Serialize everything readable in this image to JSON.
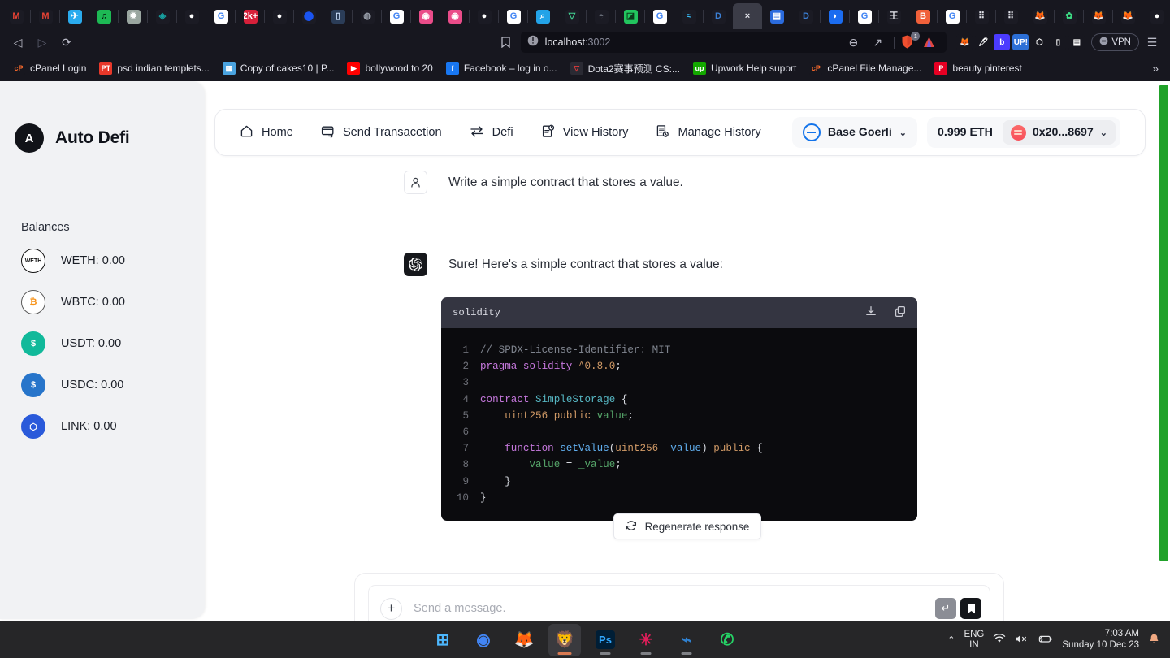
{
  "browser": {
    "tabs": [
      {
        "name": "gmail-tab",
        "icon": "M",
        "bg": "#1b1b24",
        "fg": "#ea4335",
        "active": false
      },
      {
        "name": "gmail-tab-2",
        "icon": "M",
        "bg": "#1b1b24",
        "fg": "#ea4335",
        "active": false
      },
      {
        "name": "telegram-tab",
        "icon": "✈",
        "bg": "#2aabee",
        "fg": "#ffffff",
        "active": false
      },
      {
        "name": "spotify-tab",
        "icon": "♫",
        "bg": "#1db954",
        "fg": "#000000",
        "active": false
      },
      {
        "name": "openai-tab",
        "icon": "✹",
        "bg": "#9aa6a0",
        "fg": "#ffffff",
        "active": false
      },
      {
        "name": "teal-tab",
        "icon": "◈",
        "bg": "#1b1b24",
        "fg": "#17a2a2",
        "active": false
      },
      {
        "name": "github-tab",
        "icon": "",
        "bg": "#1b1b24",
        "fg": "#ffffff",
        "active": false
      },
      {
        "name": "google-tab",
        "icon": "G",
        "bg": "#ffffff",
        "fg": "#4285f4",
        "active": false
      },
      {
        "name": "2k-tab",
        "icon": "2k+",
        "bg": "#d6203a",
        "fg": "#ffffff",
        "active": false
      },
      {
        "name": "github-tab-2",
        "icon": "",
        "bg": "#1b1b24",
        "fg": "#ffffff",
        "active": false
      },
      {
        "name": "base-tab",
        "icon": "⬤",
        "bg": "#1b1b24",
        "fg": "#1a54f0",
        "active": false
      },
      {
        "name": "gitbook-tab",
        "icon": "▯",
        "bg": "#2b3d58",
        "fg": "#cfe3ff",
        "active": false
      },
      {
        "name": "earth-tab",
        "icon": "◍",
        "bg": "#1b1b24",
        "fg": "#9aa0ab",
        "active": false
      },
      {
        "name": "google-tab-2",
        "icon": "G",
        "bg": "#ffffff",
        "fg": "#4285f4",
        "active": false
      },
      {
        "name": "dribbble-tab",
        "icon": "◉",
        "bg": "#ea4c89",
        "fg": "#ffffff",
        "active": false
      },
      {
        "name": "dribbble-tab-2",
        "icon": "◉",
        "bg": "#ea4c89",
        "fg": "#ffffff",
        "active": false
      },
      {
        "name": "github-tab-3",
        "icon": "",
        "bg": "#1b1b24",
        "fg": "#ffffff",
        "active": false
      },
      {
        "name": "google-tab-3",
        "icon": "G",
        "bg": "#ffffff",
        "fg": "#4285f4",
        "active": false
      },
      {
        "name": "search-tab",
        "icon": "⌕",
        "bg": "#23a3e8",
        "fg": "#ffffff",
        "active": false
      },
      {
        "name": "vercel-tab",
        "icon": "▽",
        "bg": "#1b1b24",
        "fg": "#42d392",
        "active": false
      },
      {
        "name": "eye-tab",
        "icon": "◓",
        "bg": "#1b1b24",
        "fg": "#6f7480",
        "active": false
      },
      {
        "name": "green-tab",
        "icon": "◪",
        "bg": "#22c55e",
        "fg": "#0a3b1b",
        "active": false
      },
      {
        "name": "google-tab-4",
        "icon": "G",
        "bg": "#ffffff",
        "fg": "#4285f4",
        "active": false
      },
      {
        "name": "tailwind-tab",
        "icon": "≈",
        "bg": "#1b1b24",
        "fg": "#38bdf8",
        "active": false
      },
      {
        "name": "dev-tab",
        "icon": "D",
        "bg": "#1b1b24",
        "fg": "#3b7fd4",
        "active": false
      },
      {
        "name": "active-localhost-tab",
        "icon": "×",
        "bg": "#3b3c47",
        "fg": "#e8e9ef",
        "active": true
      },
      {
        "name": "docs-tab",
        "icon": "▤",
        "bg": "#2b6bdd",
        "fg": "#ffffff",
        "active": false
      },
      {
        "name": "dev-tab-2",
        "icon": "D",
        "bg": "#1b1b24",
        "fg": "#3b7fd4",
        "active": false
      },
      {
        "name": "blue-tab",
        "icon": "◗",
        "bg": "#1b6cf0",
        "fg": "#ffffff",
        "active": false
      },
      {
        "name": "google-tab-5",
        "icon": "G",
        "bg": "#ffffff",
        "fg": "#4285f4",
        "active": false
      },
      {
        "name": "wang-tab",
        "icon": "王",
        "bg": "#1b1b24",
        "fg": "#e4e5ec",
        "active": false
      },
      {
        "name": "brand-tab",
        "icon": "B",
        "bg": "#f0603a",
        "fg": "#ffffff",
        "active": false
      },
      {
        "name": "google-tab-6",
        "icon": "G",
        "bg": "#ffffff",
        "fg": "#4285f4",
        "active": false
      },
      {
        "name": "grid-tab",
        "icon": "⠿",
        "bg": "#1b1b24",
        "fg": "#e4e5ec",
        "active": false
      },
      {
        "name": "grid-tab-2",
        "icon": "⠿",
        "bg": "#1b1b24",
        "fg": "#e4e5ec",
        "active": false
      },
      {
        "name": "metamask-tab",
        "icon": "🦊",
        "bg": "#1b1b24",
        "fg": "#f6851b",
        "active": false
      },
      {
        "name": "ninja-tab",
        "icon": "✿",
        "bg": "#1b1b24",
        "fg": "#3ddc84",
        "active": false
      },
      {
        "name": "metamask-tab-2",
        "icon": "🦊",
        "bg": "#1b1b24",
        "fg": "#f6851b",
        "active": false
      },
      {
        "name": "metamask-tab-3",
        "icon": "🦊",
        "bg": "#1b1b24",
        "fg": "#f6851b",
        "active": false
      },
      {
        "name": "github-tab-4",
        "icon": "",
        "bg": "#1b1b24",
        "fg": "#ffffff",
        "active": false
      },
      {
        "name": "wang-tab-2",
        "icon": "王",
        "bg": "#1b1b24",
        "fg": "#e4e5ec",
        "active": false
      },
      {
        "name": "blue-tab-2",
        "icon": "◗",
        "bg": "#1b6cf0",
        "fg": "#ffffff",
        "active": false
      }
    ],
    "new_tab_label": "+",
    "window_controls": {
      "chevron": "⌄",
      "minimize": "—",
      "maximize": "❐",
      "close": "✕"
    },
    "nav": {
      "back": "◁",
      "forward": "▷",
      "reload": "⟳",
      "bookmark": "🔖"
    },
    "address": {
      "host": "localhost",
      "port": ":3002",
      "security_icon": "info-icon"
    },
    "omni_right": {
      "zoom_out": "⊖",
      "share": "↗",
      "shield_badge": "1",
      "vpn_label": "VPN",
      "menu": "☰"
    },
    "extensions": [
      {
        "name": "metamask-extension",
        "glyph": "🦊",
        "bg": "#17171f"
      },
      {
        "name": "colorpick-extension",
        "glyph": "🖊",
        "bg": "#17171f"
      },
      {
        "name": "bitly-extension",
        "glyph": "b",
        "bg": "#4b3bff"
      },
      {
        "name": "up-extension",
        "glyph": "UP!",
        "bg": "#2c6fd6"
      },
      {
        "name": "puzzle-extension",
        "glyph": "⬡",
        "bg": "#17171f"
      },
      {
        "name": "sidebar-extension",
        "glyph": "▯",
        "bg": "#17171f"
      },
      {
        "name": "wallet-extension",
        "glyph": "▤",
        "bg": "#17171f"
      }
    ],
    "bookmarks": [
      {
        "label": "cPanel Login",
        "glyph": "cP",
        "bg": "#17171f",
        "fg": "#ff6c2c"
      },
      {
        "label": "psd indian templets...",
        "glyph": "PT",
        "bg": "#e8382a",
        "fg": "#ffffff"
      },
      {
        "label": "Copy of cakes10 | P...",
        "glyph": "▦",
        "bg": "#4aa3df",
        "fg": "#ffffff"
      },
      {
        "label": "bollywood to 20",
        "glyph": "▶",
        "bg": "#ff0000",
        "fg": "#ffffff"
      },
      {
        "label": "Facebook – log in o...",
        "glyph": "f",
        "bg": "#1877f2",
        "fg": "#ffffff"
      },
      {
        "label": "Dota2赛事预测 CS:...",
        "glyph": "▽",
        "bg": "#2a2a33",
        "fg": "#e03b3b"
      },
      {
        "label": "Upwork Help suport",
        "glyph": "up",
        "bg": "#14a800",
        "fg": "#ffffff"
      },
      {
        "label": "cPanel File Manage...",
        "glyph": "cP",
        "bg": "#17171f",
        "fg": "#ff6c2c"
      },
      {
        "label": "beauty pinterest",
        "glyph": "P",
        "bg": "#e60023",
        "fg": "#ffffff"
      }
    ],
    "bookmarks_overflow": "»"
  },
  "sidebar": {
    "brand_initial": "A",
    "brand_name": "Auto Defi",
    "balances_title": "Balances",
    "balances": [
      {
        "symbol": "WETH",
        "label": "WETH: 0.00",
        "glyph": "WETH",
        "bg": "#ffffff",
        "fg": "#111111",
        "border": "#111111"
      },
      {
        "symbol": "WBTC",
        "label": "WBTC: 0.00",
        "glyph": "₿",
        "bg": "#ffffff",
        "fg": "#f7931a",
        "border": "#5a5a5a"
      },
      {
        "symbol": "USDT",
        "label": "USDT: 0.00",
        "glyph": "$",
        "bg": "#11b99a",
        "fg": "#ffffff",
        "border": "#11b99a"
      },
      {
        "symbol": "USDC",
        "label": "USDC: 0.00",
        "glyph": "$",
        "bg": "#2775ca",
        "fg": "#ffffff",
        "border": "#2775ca"
      },
      {
        "symbol": "LINK",
        "label": "LINK: 0.00",
        "glyph": "⬡",
        "bg": "#2a5ada",
        "fg": "#ffffff",
        "border": "#2a5ada"
      }
    ]
  },
  "appnav": {
    "items": [
      {
        "label": "Home",
        "icon": "home-icon"
      },
      {
        "label": "Send Transacetion",
        "icon": "card-send-icon"
      },
      {
        "label": "Defi",
        "icon": "swap-icon"
      },
      {
        "label": "View History",
        "icon": "doc-clock-icon"
      },
      {
        "label": "Manage History",
        "icon": "list-clock-icon"
      }
    ],
    "network": {
      "label": "Base Goerli",
      "caret": "⌄"
    },
    "balance": "0.999 ETH",
    "account": {
      "address": "0x20...8697",
      "caret": "⌄"
    }
  },
  "chat": {
    "user_message": "Write a simple contract that stores a value.",
    "assistant_message": "Sure! Here's a simple contract that stores a value:",
    "user_avatar_icon": "person-icon",
    "assistant_avatar_icon": "openai-logo-icon",
    "code": {
      "language": "solidity",
      "download_icon": "download-icon",
      "copy_icon": "copy-icon",
      "lines": [
        {
          "n": "1",
          "tokens": [
            {
              "t": "// SPDX-License-Identifier: MIT",
              "c": "com"
            }
          ]
        },
        {
          "n": "2",
          "tokens": [
            {
              "t": "pragma solidity ",
              "c": "kw"
            },
            {
              "t": "^0.8.0",
              "c": "num"
            },
            {
              "t": ";",
              "c": "pln"
            }
          ]
        },
        {
          "n": "3",
          "tokens": [
            {
              "t": "",
              "c": "pln"
            }
          ]
        },
        {
          "n": "4",
          "tokens": [
            {
              "t": "contract ",
              "c": "kw"
            },
            {
              "t": "SimpleStorage",
              "c": "cls"
            },
            {
              "t": " {",
              "c": "pln"
            }
          ]
        },
        {
          "n": "5",
          "tokens": [
            {
              "t": "    uint256 ",
              "c": "typ"
            },
            {
              "t": "public ",
              "c": "typ"
            },
            {
              "t": "value",
              "c": "var"
            },
            {
              "t": ";",
              "c": "pln"
            }
          ]
        },
        {
          "n": "6",
          "tokens": [
            {
              "t": "",
              "c": "pln"
            }
          ]
        },
        {
          "n": "7",
          "tokens": [
            {
              "t": "    function ",
              "c": "kw"
            },
            {
              "t": "setValue",
              "c": "fn"
            },
            {
              "t": "(",
              "c": "pln"
            },
            {
              "t": "uint256 ",
              "c": "typ"
            },
            {
              "t": "_value",
              "c": "fn"
            },
            {
              "t": ") ",
              "c": "pln"
            },
            {
              "t": "public",
              "c": "typ"
            },
            {
              "t": " {",
              "c": "pln"
            }
          ]
        },
        {
          "n": "8",
          "tokens": [
            {
              "t": "        value",
              "c": "var"
            },
            {
              "t": " = ",
              "c": "pln"
            },
            {
              "t": "_value",
              "c": "var"
            },
            {
              "t": ";",
              "c": "pln"
            }
          ]
        },
        {
          "n": "9",
          "tokens": [
            {
              "t": "    }",
              "c": "pln"
            }
          ]
        },
        {
          "n": "10",
          "tokens": [
            {
              "t": "}",
              "c": "pln"
            }
          ]
        }
      ]
    },
    "regenerate_label": "Regenerate response",
    "regenerate_icon": "refresh-icon",
    "composer": {
      "placeholder": "Send a message.",
      "value": "",
      "plus_label": "+",
      "send_glyph": "↵",
      "save_glyph": "🔖"
    }
  },
  "taskbar": {
    "apps": [
      {
        "name": "start-button",
        "glyph": "⊞",
        "bg": "transparent",
        "fg": "#4db8ff",
        "active": false,
        "running": false
      },
      {
        "name": "chrome-app",
        "glyph": "◉",
        "bg": "transparent",
        "fg": "#4285f4",
        "active": false,
        "running": false
      },
      {
        "name": "firefox-app",
        "glyph": "🦊",
        "bg": "transparent",
        "fg": "#ff7139",
        "active": false,
        "running": false
      },
      {
        "name": "brave-app",
        "glyph": "🦁",
        "bg": "#3a3a3e",
        "fg": "#fb542b",
        "active": true,
        "running": true
      },
      {
        "name": "photoshop-app",
        "glyph": "Ps",
        "bg": "#001e36",
        "fg": "#31a8ff",
        "active": false,
        "running": true
      },
      {
        "name": "slack-app",
        "glyph": "✳",
        "bg": "transparent",
        "fg": "#e01e5a",
        "active": false,
        "running": true
      },
      {
        "name": "vscode-app",
        "glyph": "⌁",
        "bg": "transparent",
        "fg": "#2f80d0",
        "active": false,
        "running": true
      },
      {
        "name": "whatsapp-app",
        "glyph": "✆",
        "bg": "transparent",
        "fg": "#25d366",
        "active": false,
        "running": false
      }
    ],
    "tray": {
      "chevron": "⌃",
      "lang_primary": "ENG",
      "lang_secondary": "IN",
      "wifi": "wifi-icon",
      "volume": "volume-muted-icon",
      "battery": "battery-icon",
      "time": "7:03 AM",
      "date": "Sunday 10 Dec 23",
      "notification": "bell-icon"
    }
  }
}
